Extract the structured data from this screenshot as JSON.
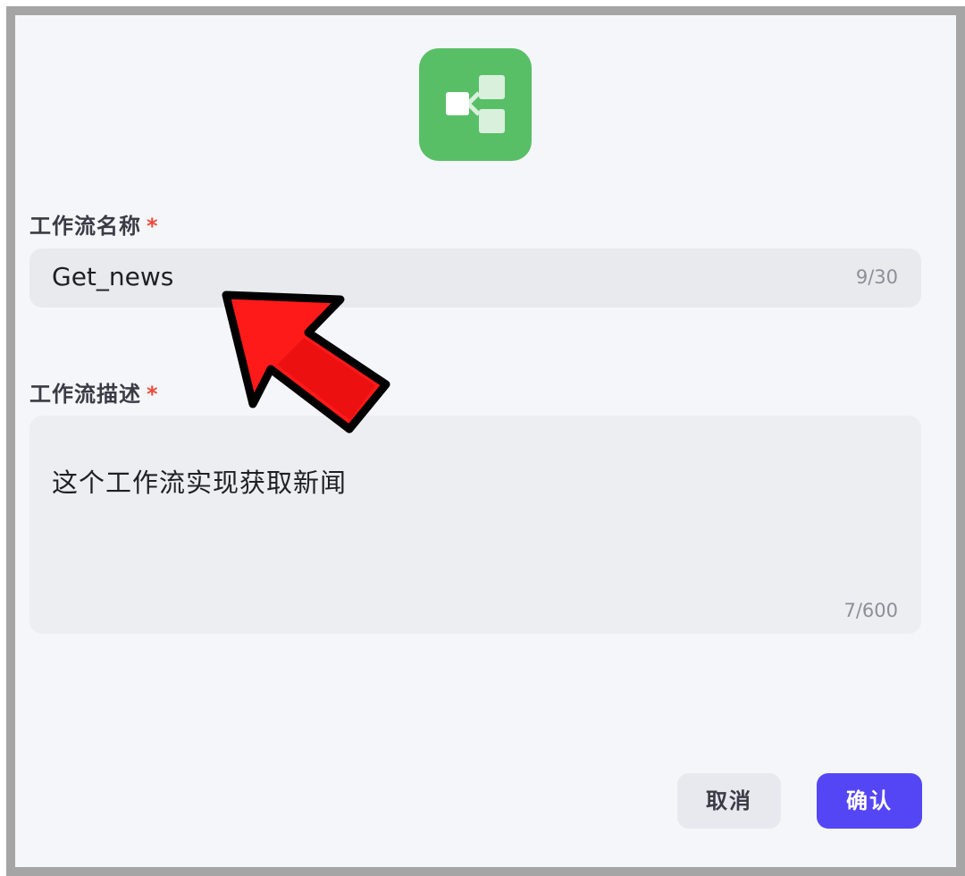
{
  "dialog": {
    "icon": "workflow-icon",
    "accent_color": "#58bf67",
    "primary_color": "#5546f5"
  },
  "name_field": {
    "label": "工作流名称",
    "required_mark": "*",
    "value": "Get_news",
    "counter": "9/30"
  },
  "description_field": {
    "label": "工作流描述",
    "required_mark": "*",
    "value": "这个工作流实现获取新闻",
    "counter": "7/600"
  },
  "buttons": {
    "cancel_label": "取消",
    "confirm_label": "确认"
  },
  "annotation": {
    "icon": "red-arrow-icon",
    "color": "#ff0000"
  }
}
